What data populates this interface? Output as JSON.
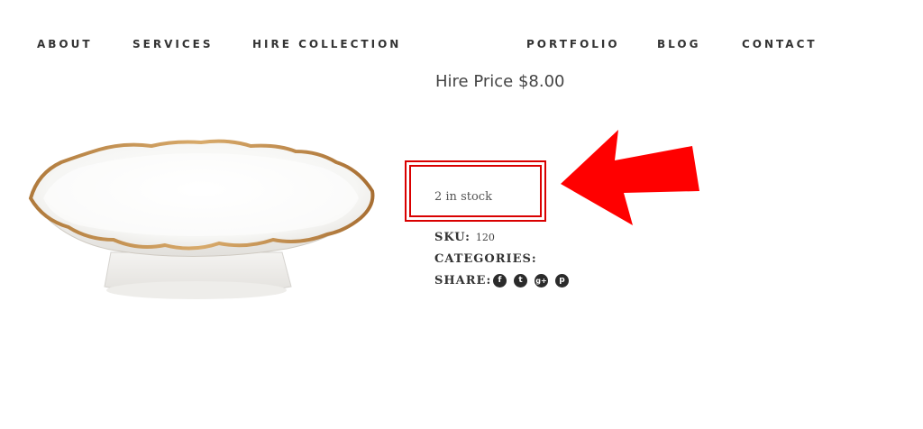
{
  "nav": {
    "about": "ABOUT",
    "services": "SERVICES",
    "hire_collection": "HIRE COLLECTION",
    "portfolio": "PORTFOLIO",
    "blog": "BLOG",
    "contact": "CONTACT"
  },
  "product": {
    "price": "Hire Price $8.00",
    "stock": "2 in stock",
    "sku_label": "SKU:",
    "sku_value": "120",
    "categories_label": "CATEGORIES:",
    "share_label": "SHARE:"
  },
  "share_icons": [
    {
      "name": "facebook-icon",
      "glyph": "f"
    },
    {
      "name": "twitter-icon",
      "glyph": "t"
    },
    {
      "name": "google-plus-icon",
      "glyph": "g+"
    },
    {
      "name": "pinterest-icon",
      "glyph": "p"
    }
  ],
  "colors": {
    "highlight": "#d90000",
    "arrow": "#ff0000",
    "icon_bg": "#2b2b2b"
  }
}
